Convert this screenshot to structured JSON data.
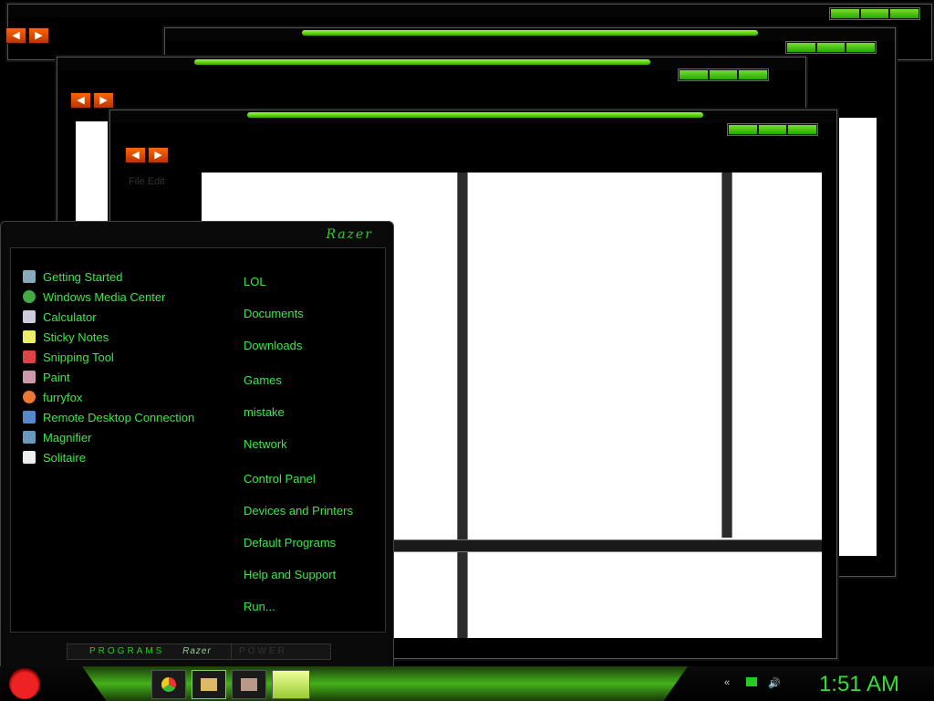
{
  "start_menu": {
    "brand": "Razer",
    "programs": [
      {
        "label": "Getting Started",
        "icon": "getting-started-icon"
      },
      {
        "label": "Windows Media Center",
        "icon": "media-center-icon"
      },
      {
        "label": "Calculator",
        "icon": "calculator-icon"
      },
      {
        "label": "Sticky Notes",
        "icon": "sticky-notes-icon"
      },
      {
        "label": "Snipping Tool",
        "icon": "snipping-tool-icon"
      },
      {
        "label": "Paint",
        "icon": "paint-icon"
      },
      {
        "label": "furryfox",
        "icon": "firefox-icon"
      },
      {
        "label": "Remote Desktop Connection",
        "icon": "remote-desktop-icon"
      },
      {
        "label": "Magnifier",
        "icon": "magnifier-icon"
      },
      {
        "label": "Solitaire",
        "icon": "solitaire-icon"
      }
    ],
    "places": [
      "LOL",
      "Documents",
      "Downloads",
      "Games",
      "mistake",
      "Network",
      "Control Panel",
      "Devices and Printers",
      "Default Programs",
      "Help and Support",
      "Run..."
    ],
    "footer_programs": "PROGRAMS",
    "footer_brand": "Razer",
    "footer_power": "POWER"
  },
  "window": {
    "menu_text": "File  Edit"
  },
  "taskbar": {
    "clock": "1:51 AM",
    "start_icon": "angry-bird-icon",
    "pinned": [
      "chrome-icon",
      "folder-icon",
      "media-icon"
    ]
  },
  "colors": {
    "accent": "#39e84a",
    "nav": "#e2561a"
  }
}
